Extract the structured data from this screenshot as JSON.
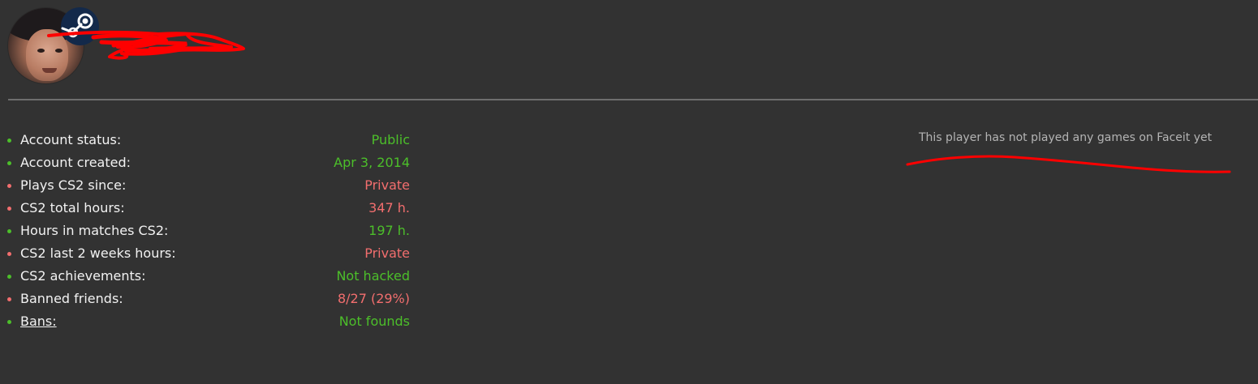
{
  "profile": {
    "avatar_icon": "user-avatar",
    "platform_icon": "steam-icon",
    "name_redacted": true
  },
  "stats": [
    {
      "label": "Account status:",
      "value": "Public",
      "status": "good"
    },
    {
      "label": "Account created:",
      "value": "Apr 3, 2014",
      "status": "good"
    },
    {
      "label": "Plays CS2 since:",
      "value": "Private",
      "status": "bad"
    },
    {
      "label": "CS2 total hours:",
      "value": "347 h.",
      "status": "bad"
    },
    {
      "label": "Hours in matches CS2:",
      "value": "197 h.",
      "status": "good"
    },
    {
      "label": "CS2 last 2 weeks hours:",
      "value": "Private",
      "status": "bad"
    },
    {
      "label": "CS2 achievements:",
      "value": "Not hacked",
      "status": "good"
    },
    {
      "label": "Banned friends:",
      "value": "8/27 (29%)",
      "status": "bad"
    },
    {
      "label": "Bans:",
      "value": "Not founds",
      "status": "good"
    }
  ],
  "faceit": {
    "message": "This player has not played any games on Faceit yet"
  },
  "colors": {
    "background": "#323232",
    "good": "#4cbf2a",
    "bad": "#f26e6e",
    "annotation": "#ff0000"
  }
}
